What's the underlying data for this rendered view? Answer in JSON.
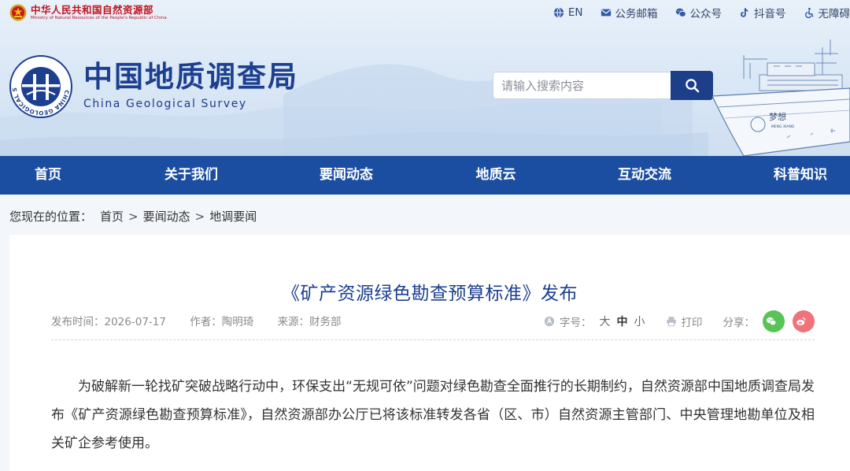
{
  "topbar": {
    "ministry_name": "中华人民共和国自然资源部",
    "ministry_en": "Ministry of Natural Resources of the People's Republic of China",
    "links": [
      {
        "icon": "globe-icon",
        "label": "EN"
      },
      {
        "icon": "mail-icon",
        "label": "公务邮箱"
      },
      {
        "icon": "wechat-icon",
        "label": "公众号"
      },
      {
        "icon": "tiktok-icon",
        "label": "抖音号"
      },
      {
        "icon": "accessibility-icon",
        "label": "无障碍"
      }
    ]
  },
  "header": {
    "title_cn": "中国地质调查局",
    "title_en": "China Geological Survey",
    "emblem_text": "CHINA GEOLOGICAL SURVEY",
    "ship_name_cn": "梦想",
    "ship_name_en": "MENG XIANG"
  },
  "search": {
    "placeholder": "请输入搜索内容",
    "value": ""
  },
  "nav": [
    "首页",
    "关于我们",
    "要闻动态",
    "地质云",
    "互动交流",
    "科普知识"
  ],
  "breadcrumb": {
    "label": "您现在的位置：",
    "items": [
      "首页",
      "要闻动态",
      "地调要闻"
    ],
    "separator": ">"
  },
  "article": {
    "title": "《矿产资源绿色勘查预算标准》发布",
    "publish": "发布时间：2026-07-17",
    "author": "作者：陶明琦",
    "source": "来源：财务部",
    "font_size_label": "字号：",
    "font_sizes": [
      "大",
      "中",
      "小"
    ],
    "print_label": "打印",
    "share_label": "分享：",
    "share_colors": {
      "wechat": "#5ac358",
      "weibo": "#f0727a"
    },
    "body": "为破解新一轮找矿突破战略行动中，环保支出“无规可依”问题对绿色勘查全面推行的长期制约，自然资源部中国地质调查局发布《矿产资源绿色勘查预算标准》，自然资源部办公厅已将该标准转发各省（区、市）自然资源主管部门、中央管理地勘单位及相关矿企参考使用。"
  }
}
